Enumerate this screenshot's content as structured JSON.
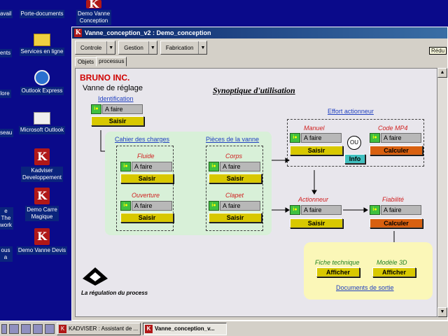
{
  "desktop": {
    "icons": [
      {
        "label": "avail",
        "kind": "partial"
      },
      {
        "label": "Porte-documents",
        "kind": "doc"
      },
      {
        "label": "Demo Vanne\nConception",
        "kind": "k"
      },
      {
        "label": "ents",
        "kind": "partial"
      },
      {
        "label": "Services en ligne",
        "kind": "folder"
      },
      {
        "label": "lore",
        "kind": "partial"
      },
      {
        "label": "Outlook Express",
        "kind": "globe"
      },
      {
        "label": "seau",
        "kind": "partial"
      },
      {
        "label": "Microsoft Outlook",
        "kind": "mail"
      },
      {
        "label": "Kadviser\nDeveloppement",
        "kind": "k"
      },
      {
        "label": "e The\nwork",
        "kind": "partial"
      },
      {
        "label": "Demo Carre\nMagique",
        "kind": "k"
      },
      {
        "label": "ous a",
        "kind": "partial"
      },
      {
        "label": "Demo Vanne Devis",
        "kind": "k"
      }
    ]
  },
  "window": {
    "title": "Vanne_conception_v2 : Demo_conception",
    "icon": "k-logo",
    "toolbar": [
      {
        "label": "Controle"
      },
      {
        "label": "Gestion"
      },
      {
        "label": "Fabrication"
      }
    ],
    "tabs": [
      {
        "label": "Objets"
      },
      {
        "label": "processus",
        "active": true
      }
    ],
    "tooltip": "Rédu"
  },
  "canvas": {
    "brand": "BRUNO INC.",
    "subtitle": "Vanne de réglage",
    "synoptique": "Synoptique d'utilisation",
    "identification": {
      "title": "Identification",
      "status": "A faire",
      "button": "Saisir"
    },
    "cahier": {
      "title": "Cahier des charges"
    },
    "fluide": {
      "title": "Fluide",
      "status": "A faire",
      "button": "Saisir"
    },
    "ouverture": {
      "title": "Ouverture",
      "status": "A faire",
      "button": "Saisir"
    },
    "pieces": {
      "title": "Pièces de la vanne"
    },
    "corps": {
      "title": "Corps",
      "status": "A faire",
      "button": "Saisir"
    },
    "clapet": {
      "title": "Clapet",
      "status": "A faire",
      "button": "Saisir"
    },
    "effort": {
      "title": "Effort actionneur"
    },
    "manuel": {
      "title": "Manuel",
      "status": "A faire",
      "button": "Saisir"
    },
    "ou_label": "OU",
    "info_button": "Info",
    "code_mp4": {
      "title": "Code MP4",
      "status": "A faire",
      "button": "Calculer"
    },
    "actionneur": {
      "title": "Actionneur",
      "status": "A faire",
      "button": "Saisir"
    },
    "fiabilite": {
      "title": "Fiabilité",
      "status": "A faire",
      "button": "Calculer"
    },
    "fiche": {
      "title": "Fiche technique",
      "button": "Afficher"
    },
    "modele": {
      "title": "Modèle 3D",
      "button": "Afficher"
    },
    "documents": "Documents de sortie",
    "logo_text": "La régulation du process"
  },
  "taskbar": {
    "tasks": [
      {
        "label": "KADVISER : Assistant de ..."
      },
      {
        "label": "Vanne_conception_v...",
        "active": true
      }
    ]
  },
  "colors": {
    "desktop": "#0a0a8a",
    "title_start": "#0a246a",
    "title_end": "#3a6ea5",
    "saisir": "#d8c800",
    "calculer": "#d86010",
    "info": "#40c0c0",
    "status_icon": "#40c040",
    "red_label": "#d02020",
    "green_label": "#208020",
    "link": "#2040c0"
  }
}
